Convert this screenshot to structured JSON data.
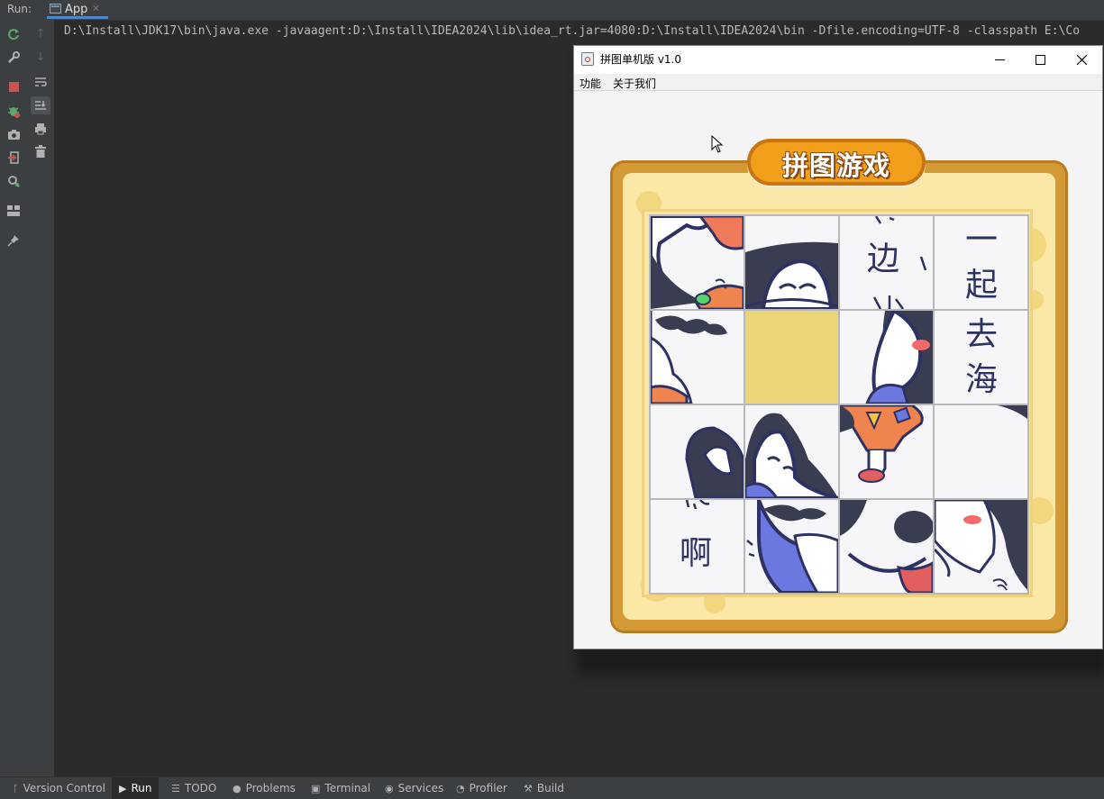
{
  "ide": {
    "run_label": "Run:",
    "run_tab": "App",
    "console_line": "D:\\Install\\JDK17\\bin\\java.exe -javaagent:D:\\Install\\IDEA2024\\lib\\idea_rt.jar=4080:D:\\Install\\IDEA2024\\bin -Dfile.encoding=UTF-8 -classpath E:\\Co"
  },
  "statusbar": {
    "items": [
      {
        "label": "Version Control",
        "icon": "branch-icon"
      },
      {
        "label": "Run",
        "icon": "run-icon"
      },
      {
        "label": "TODO",
        "icon": "list-icon"
      },
      {
        "label": "Problems",
        "icon": "info-icon"
      },
      {
        "label": "Terminal",
        "icon": "terminal-icon"
      },
      {
        "label": "Services",
        "icon": "services-icon"
      },
      {
        "label": "Profiler",
        "icon": "profiler-icon"
      },
      {
        "label": "Build",
        "icon": "hammer-icon"
      }
    ]
  },
  "game_window": {
    "title": "拼图单机版 v1.0",
    "menus": [
      "功能",
      "关于我们"
    ],
    "banner": "拼图游戏"
  },
  "puzzle": {
    "grid": "4x4",
    "blank_tile": {
      "row": 2,
      "col": 2
    },
    "tile_text": {
      "r1c3": "边",
      "r1c4": "一 起",
      "r2c4": "去 海",
      "r4c1": "啊"
    }
  },
  "colors": {
    "ide_bg": "#2b2b2b",
    "toolbar_bg": "#3c3f41",
    "frame": "#d39a35",
    "banner": "#f2a01c",
    "blank_tile": "#ecd477",
    "ink": "#2e3263"
  }
}
